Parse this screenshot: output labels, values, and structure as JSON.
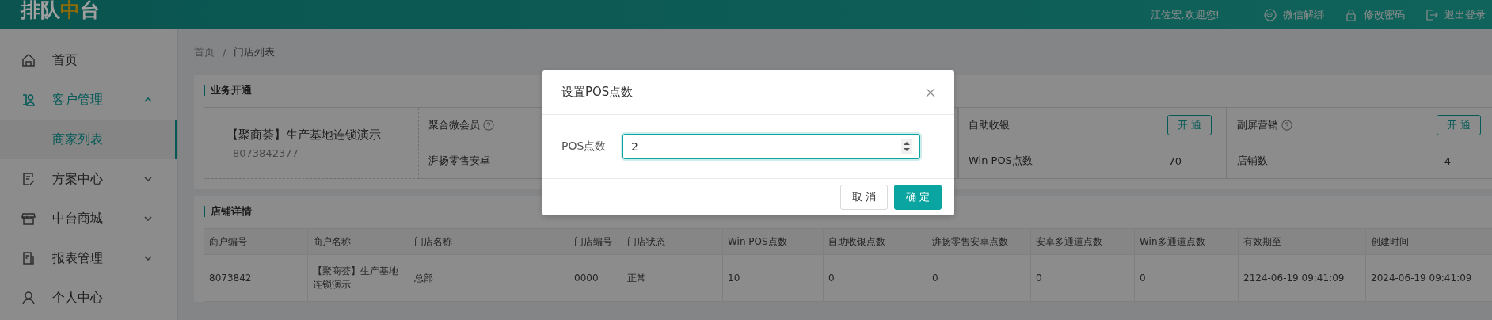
{
  "header": {
    "logo": [
      {
        "text": "排队",
        "color": "#a0a0a0"
      },
      {
        "text": "中",
        "color": "#8c6c0a"
      },
      {
        "text": "台",
        "color": "#a0a0a0"
      }
    ],
    "greeting": "江佐宏,欢迎您!",
    "actions": [
      {
        "label": "微信解绑"
      },
      {
        "label": "修改密码"
      },
      {
        "label": "退出登录"
      }
    ]
  },
  "sidebar": {
    "items": [
      {
        "label": "首页",
        "selected": false
      },
      {
        "label": "客户管理",
        "expanded": true,
        "children": [
          {
            "label": "商家列表",
            "selected": true
          }
        ]
      },
      {
        "label": "方案中心",
        "expanded": false
      },
      {
        "label": "中台商城",
        "expanded": false
      },
      {
        "label": "报表管理",
        "expanded": false
      },
      {
        "label": "个人中心",
        "selected": false
      }
    ]
  },
  "breadcrumb": {
    "items": [
      "首页",
      "门店列表"
    ],
    "separator": "/"
  },
  "business": {
    "title": "业务开通",
    "merchant": {
      "name": "【聚商荟】生产基地连锁演示",
      "id": "8073842377"
    },
    "services": [
      {
        "name": "聚合微会员",
        "help": true,
        "metric": "湃扬零售安卓"
      },
      {
        "name": "自助收银",
        "help": false,
        "button": "开 通",
        "metric": "Win POS点数",
        "value": "70"
      },
      {
        "name": "副屏营销",
        "help": true,
        "button": "开 通",
        "metric": "店铺数",
        "value": "4"
      }
    ]
  },
  "stores": {
    "title": "店铺详情",
    "columns": [
      "商户编号",
      "商户名称",
      "门店名称",
      "门店编号",
      "门店状态",
      "Win POS点数",
      "自助收银点数",
      "湃扬零售安卓点数",
      "安卓多通道点数",
      "Win多通道点数",
      "有效期至",
      "创建时间"
    ],
    "rows": [
      [
        "8073842",
        "【聚商荟】生产基地连锁演示",
        "总部",
        "0000",
        "正常",
        "10",
        "0",
        "0",
        "0",
        "0",
        "2124-06-19 09:41:09",
        "2024-06-19 09:41:09"
      ]
    ]
  },
  "dialog": {
    "title": "设置POS点数",
    "field": {
      "label": "POS点数",
      "value": "2",
      "focused": true
    },
    "buttons": [
      {
        "label": "取 消",
        "primary": false
      },
      {
        "label": "确 定",
        "primary": true
      }
    ]
  }
}
